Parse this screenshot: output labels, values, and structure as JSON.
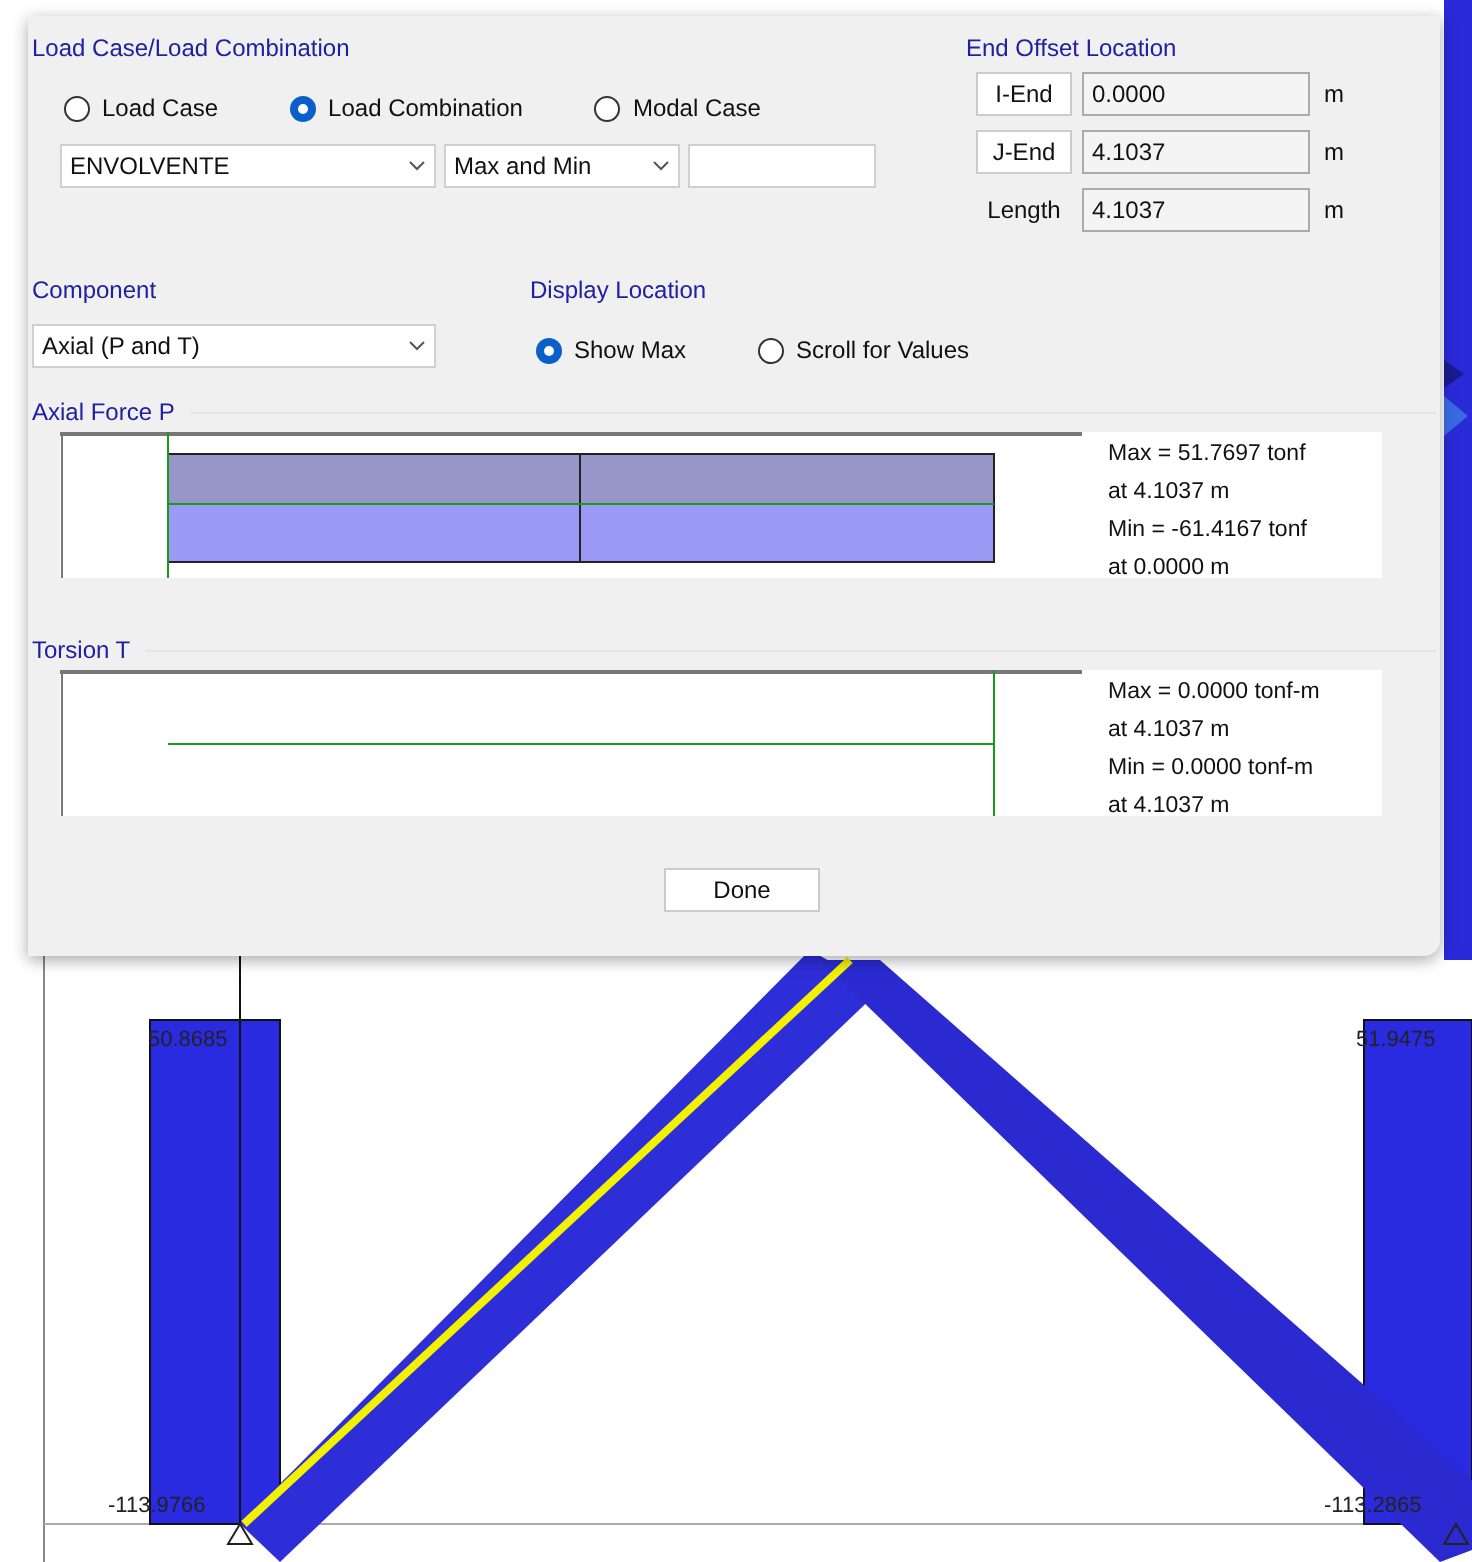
{
  "dialog": {
    "load_case": {
      "title": "Load Case/Load Combination",
      "options": [
        {
          "label": "Load Case",
          "selected": false
        },
        {
          "label": "Load Combination",
          "selected": true
        },
        {
          "label": "Modal Case",
          "selected": false
        }
      ],
      "combination": "ENVOLVENTE",
      "mode": "Max and Min"
    },
    "end_offset": {
      "title": "End Offset Location",
      "rows": [
        {
          "label": "I-End",
          "kind": "button",
          "value": "0.0000",
          "unit": "m"
        },
        {
          "label": "J-End",
          "kind": "button",
          "value": "4.1037",
          "unit": "m"
        },
        {
          "label": "Length",
          "kind": "label",
          "value": "4.1037",
          "unit": "m"
        }
      ]
    },
    "component": {
      "title": "Component",
      "value": "Axial (P and T)"
    },
    "display_location": {
      "title": "Display Location",
      "options": [
        {
          "label": "Show Max",
          "selected": true
        },
        {
          "label": "Scroll for Values",
          "selected": false
        }
      ]
    },
    "plots": [
      {
        "title": "Axial Force P",
        "kind": "axial",
        "lines": [
          "Max = 51.7697 tonf",
          "at 4.1037 m",
          "Min = -61.4167 tonf",
          "at 0.0000 m"
        ]
      },
      {
        "title": "Torsion T",
        "kind": "torsion",
        "lines": [
          "Max = 0.0000 tonf-m",
          "at 4.1037 m",
          "Min = 0.0000 tonf-m",
          "at 4.1037 m"
        ]
      }
    ],
    "done_button": "Done"
  },
  "canvas": {
    "labels": [
      "50.8685",
      "51.9475",
      "-113.9766",
      "-113.2865"
    ]
  }
}
